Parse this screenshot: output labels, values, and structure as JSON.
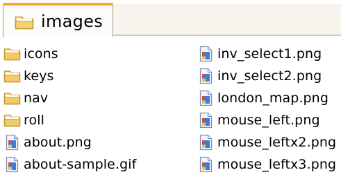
{
  "tab": {
    "label": "images"
  },
  "colors": {
    "tab_accent": "#f6a827",
    "tab_background": "#fcfcfb",
    "tabstrip_background": "#f6f4ec",
    "folder": "#e8c25a"
  },
  "files": {
    "left": [
      {
        "name": "icons",
        "icon": "folder-icon"
      },
      {
        "name": "keys",
        "icon": "folder-icon"
      },
      {
        "name": "nav",
        "icon": "folder-icon"
      },
      {
        "name": "roll",
        "icon": "folder-icon"
      },
      {
        "name": "about.png",
        "icon": "image-file-icon"
      },
      {
        "name": "about-sample.gif",
        "icon": "image-file-icon"
      }
    ],
    "right": [
      {
        "name": "inv_select1.png",
        "icon": "image-file-icon"
      },
      {
        "name": "inv_select2.png",
        "icon": "image-file-icon"
      },
      {
        "name": "london_map.png",
        "icon": "image-file-icon"
      },
      {
        "name": "mouse_left.png",
        "icon": "image-file-icon"
      },
      {
        "name": "mouse_leftx2.png",
        "icon": "image-file-icon"
      },
      {
        "name": "mouse_leftx3.png",
        "icon": "image-file-icon"
      }
    ]
  }
}
